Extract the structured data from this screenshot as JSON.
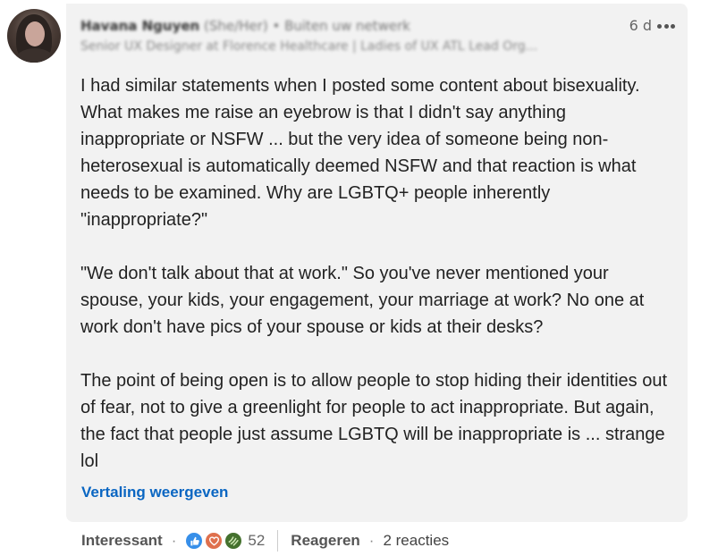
{
  "author": {
    "name": "Havana Nguyen",
    "pronouns": "(She/Her)",
    "connection": "• Buiten uw netwerk",
    "headline": "Senior UX Designer at Florence Healthcare | Ladies of UX ATL Lead Org..."
  },
  "timestamp": "6 d",
  "more_icon": "more-horizontal-icon",
  "body": {
    "p1": "I had similar statements when I posted some content about bisexuality. What makes me raise an eyebrow is that I didn't say anything inappropriate or NSFW ... but the very idea of someone being non-heterosexual is automatically deemed NSFW and that reaction is what needs to be examined. Why are LGBTQ+ people inherently \"inappropriate?\"",
    "p2": "\"We don't talk about that at work.\" So you've never mentioned your spouse, your kids, your engagement, your marriage at work? No one at work don't have pics of your spouse or kids at their desks?",
    "p3": "The point of being open is to allow people to stop hiding their identities out of fear, not to give a greenlight for people to act inappropriate. But again, the fact that people just assume LGBTQ will be inappropriate is ... strange lol"
  },
  "translate_label": "Vertaling weergeven",
  "actions": {
    "react_label": "Interessant",
    "reactions": [
      "like-icon",
      "love-icon",
      "support-icon"
    ],
    "reaction_count": "52",
    "reply_label": "Reageren",
    "replies_count_label": "2 reacties"
  },
  "colors": {
    "bubble_bg": "#f2f2f2",
    "link": "#0a66c2",
    "like": "#378fe9",
    "love": "#df704d",
    "support": "#44712e"
  }
}
